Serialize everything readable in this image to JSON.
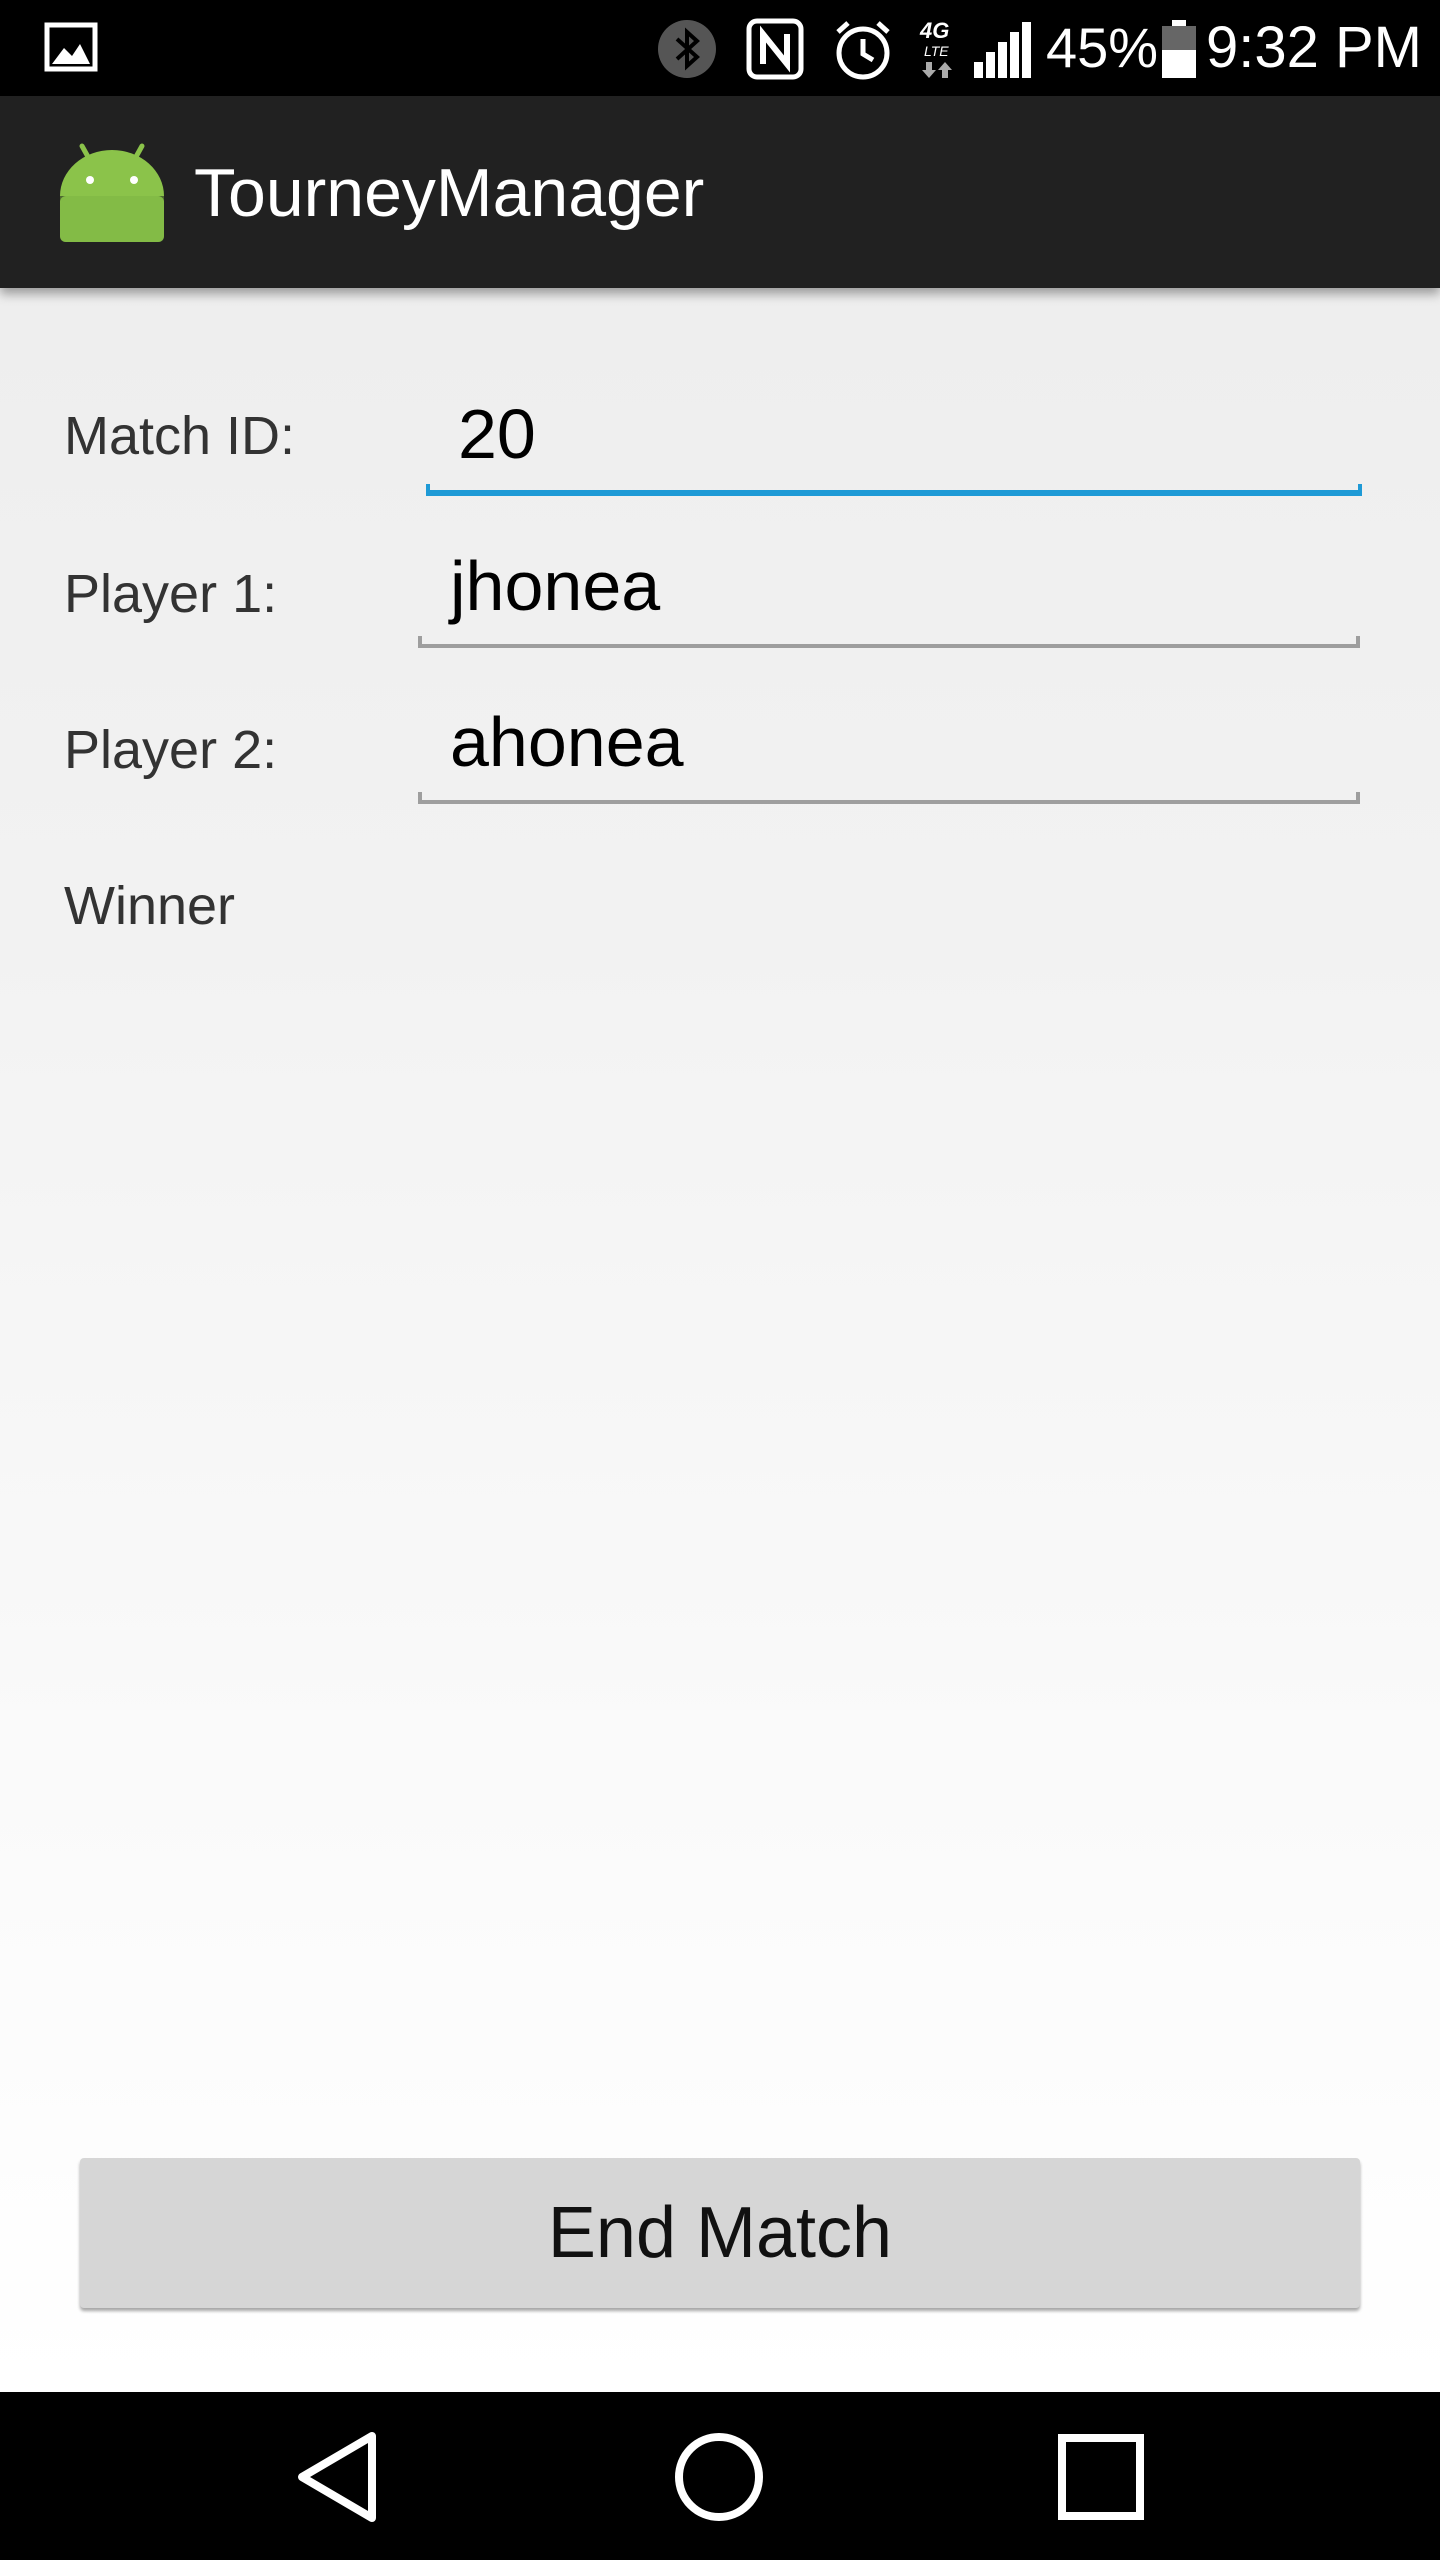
{
  "status_bar": {
    "battery_percent": "45%",
    "time": "9:32 PM",
    "network": "4G LTE",
    "icons": [
      "gallery-icon",
      "bluetooth-icon",
      "nfc-icon",
      "alarm-icon",
      "network-4g-lte-icon",
      "signal-icon",
      "battery-icon"
    ]
  },
  "action_bar": {
    "title": "TourneyManager",
    "app_icon": "android-icon"
  },
  "form": {
    "match_id_label": "Match ID:",
    "match_id_value": "20",
    "player1_label": "Player 1:",
    "player1_value": "jhonea",
    "player2_label": "Player 2:",
    "player2_value": "ahonea",
    "winner_label": "Winner"
  },
  "end_button_label": "End Match",
  "nav_bar": {
    "icons": [
      "back-icon",
      "home-icon",
      "recents-icon"
    ]
  },
  "colors": {
    "accent": "#1e9ad6",
    "action_bar": "#212121",
    "android_green": "#8bc34a"
  }
}
